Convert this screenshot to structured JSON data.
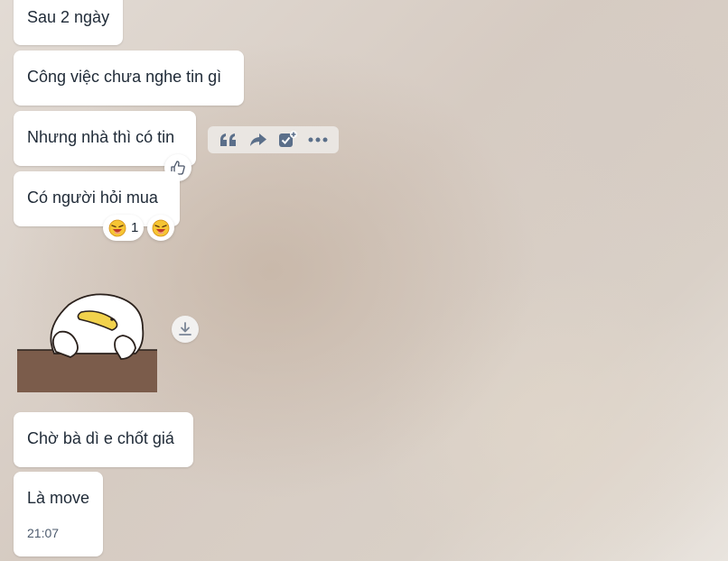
{
  "messages": [
    {
      "text": "Sau 2 ngày"
    },
    {
      "text": "Công việc chưa nghe tin gì"
    },
    {
      "text": "Nhưng nhà thì có tin"
    },
    {
      "text": "Có người hỏi mua"
    },
    {
      "text": "Chờ bà dì e chốt giá"
    },
    {
      "text": "Là move",
      "time": "21:07"
    }
  ],
  "message_toolbar": {
    "icons": [
      "quote-icon",
      "forward-icon",
      "add-task-icon",
      "more-icon"
    ]
  },
  "reactions": {
    "like_icon": "thumbs-up-icon",
    "laugh_emoji": "laughing-face-emoji",
    "laugh_count": "1"
  },
  "sticker": {
    "name": "duck-leaning-on-table-sticker"
  },
  "colors": {
    "bubble": "#ffffff",
    "text": "#1f2a37",
    "icon": "#5b6f8a",
    "time": "#4d5b6e"
  }
}
